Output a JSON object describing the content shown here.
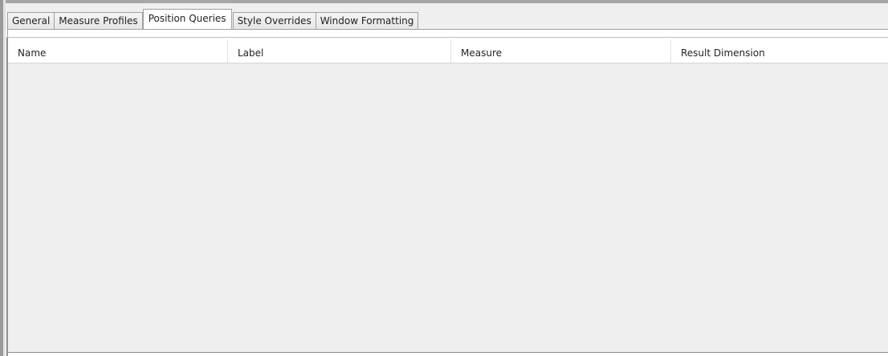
{
  "tabs": [
    {
      "label": "General",
      "active": false
    },
    {
      "label": "Measure Profiles",
      "active": false
    },
    {
      "label": "Position Queries",
      "active": true
    },
    {
      "label": "Style Overrides",
      "active": false
    },
    {
      "label": "Window Formatting",
      "active": false
    }
  ],
  "table": {
    "columns": [
      "Name",
      "Label",
      "Measure",
      "Result Dimension"
    ],
    "rows": []
  }
}
